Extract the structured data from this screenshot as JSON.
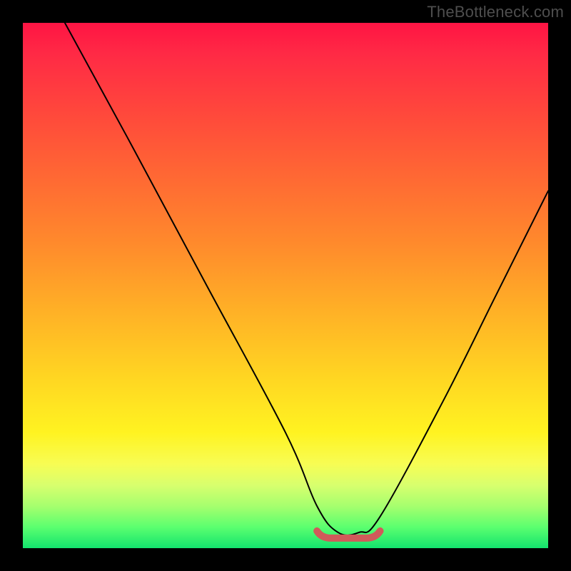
{
  "watermark": "TheBottleneck.com",
  "colors": {
    "frame": "#000000",
    "curve": "#000000",
    "bottom_segment": "#d15a5a"
  },
  "chart_data": {
    "type": "line",
    "title": "",
    "xlabel": "",
    "ylabel": "",
    "xlim": [
      0,
      100
    ],
    "ylim": [
      0,
      100
    ],
    "grid": false,
    "legend": false,
    "series": [
      {
        "name": "bottleneck-curve",
        "x": [
          8,
          20,
          35,
          50,
          56,
          60,
          64,
          68,
          80,
          90,
          100
        ],
        "y": [
          100,
          78,
          50,
          22,
          8,
          3,
          3,
          6,
          28,
          48,
          68
        ]
      }
    ],
    "annotations": [
      {
        "name": "valley-highlight",
        "x_range": [
          56,
          68
        ],
        "y": 3,
        "note": "flat valley segment drawn thick in accent color"
      }
    ]
  }
}
